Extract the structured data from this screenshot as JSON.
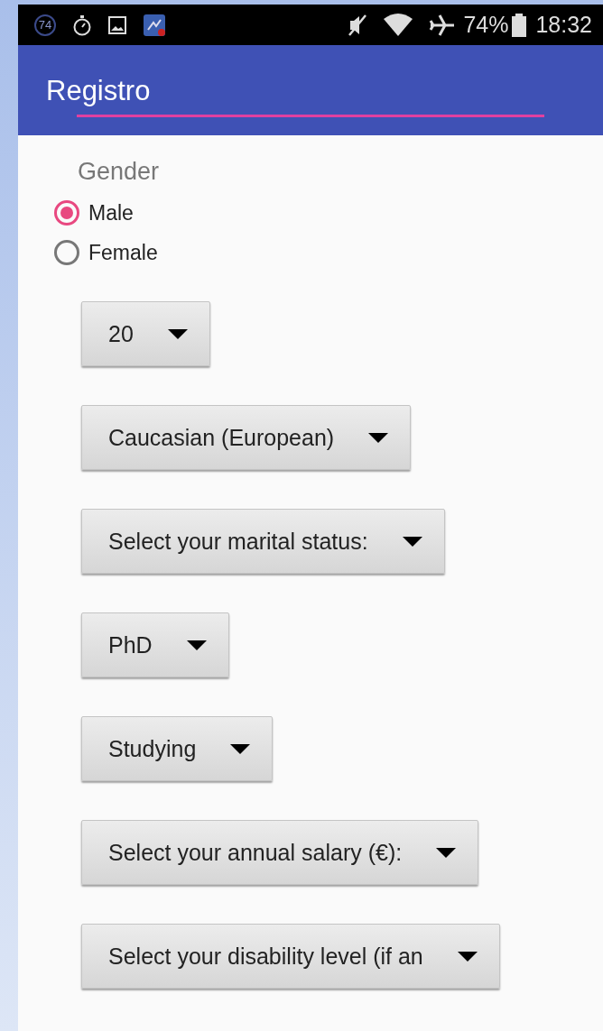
{
  "status_bar": {
    "notification_badge": "74",
    "battery": "74%",
    "time": "18:32"
  },
  "app_bar": {
    "title": "Registro"
  },
  "gender": {
    "label": "Gender",
    "options": [
      {
        "label": "Male",
        "selected": true
      },
      {
        "label": "Female",
        "selected": false
      }
    ]
  },
  "dropdowns": [
    {
      "value": "20"
    },
    {
      "value": "Caucasian (European)"
    },
    {
      "value": "Select your marital status:"
    },
    {
      "value": "PhD"
    },
    {
      "value": "Studying"
    },
    {
      "value": "Select your annual salary (€):"
    },
    {
      "value": "Select your disability level (if an"
    }
  ]
}
